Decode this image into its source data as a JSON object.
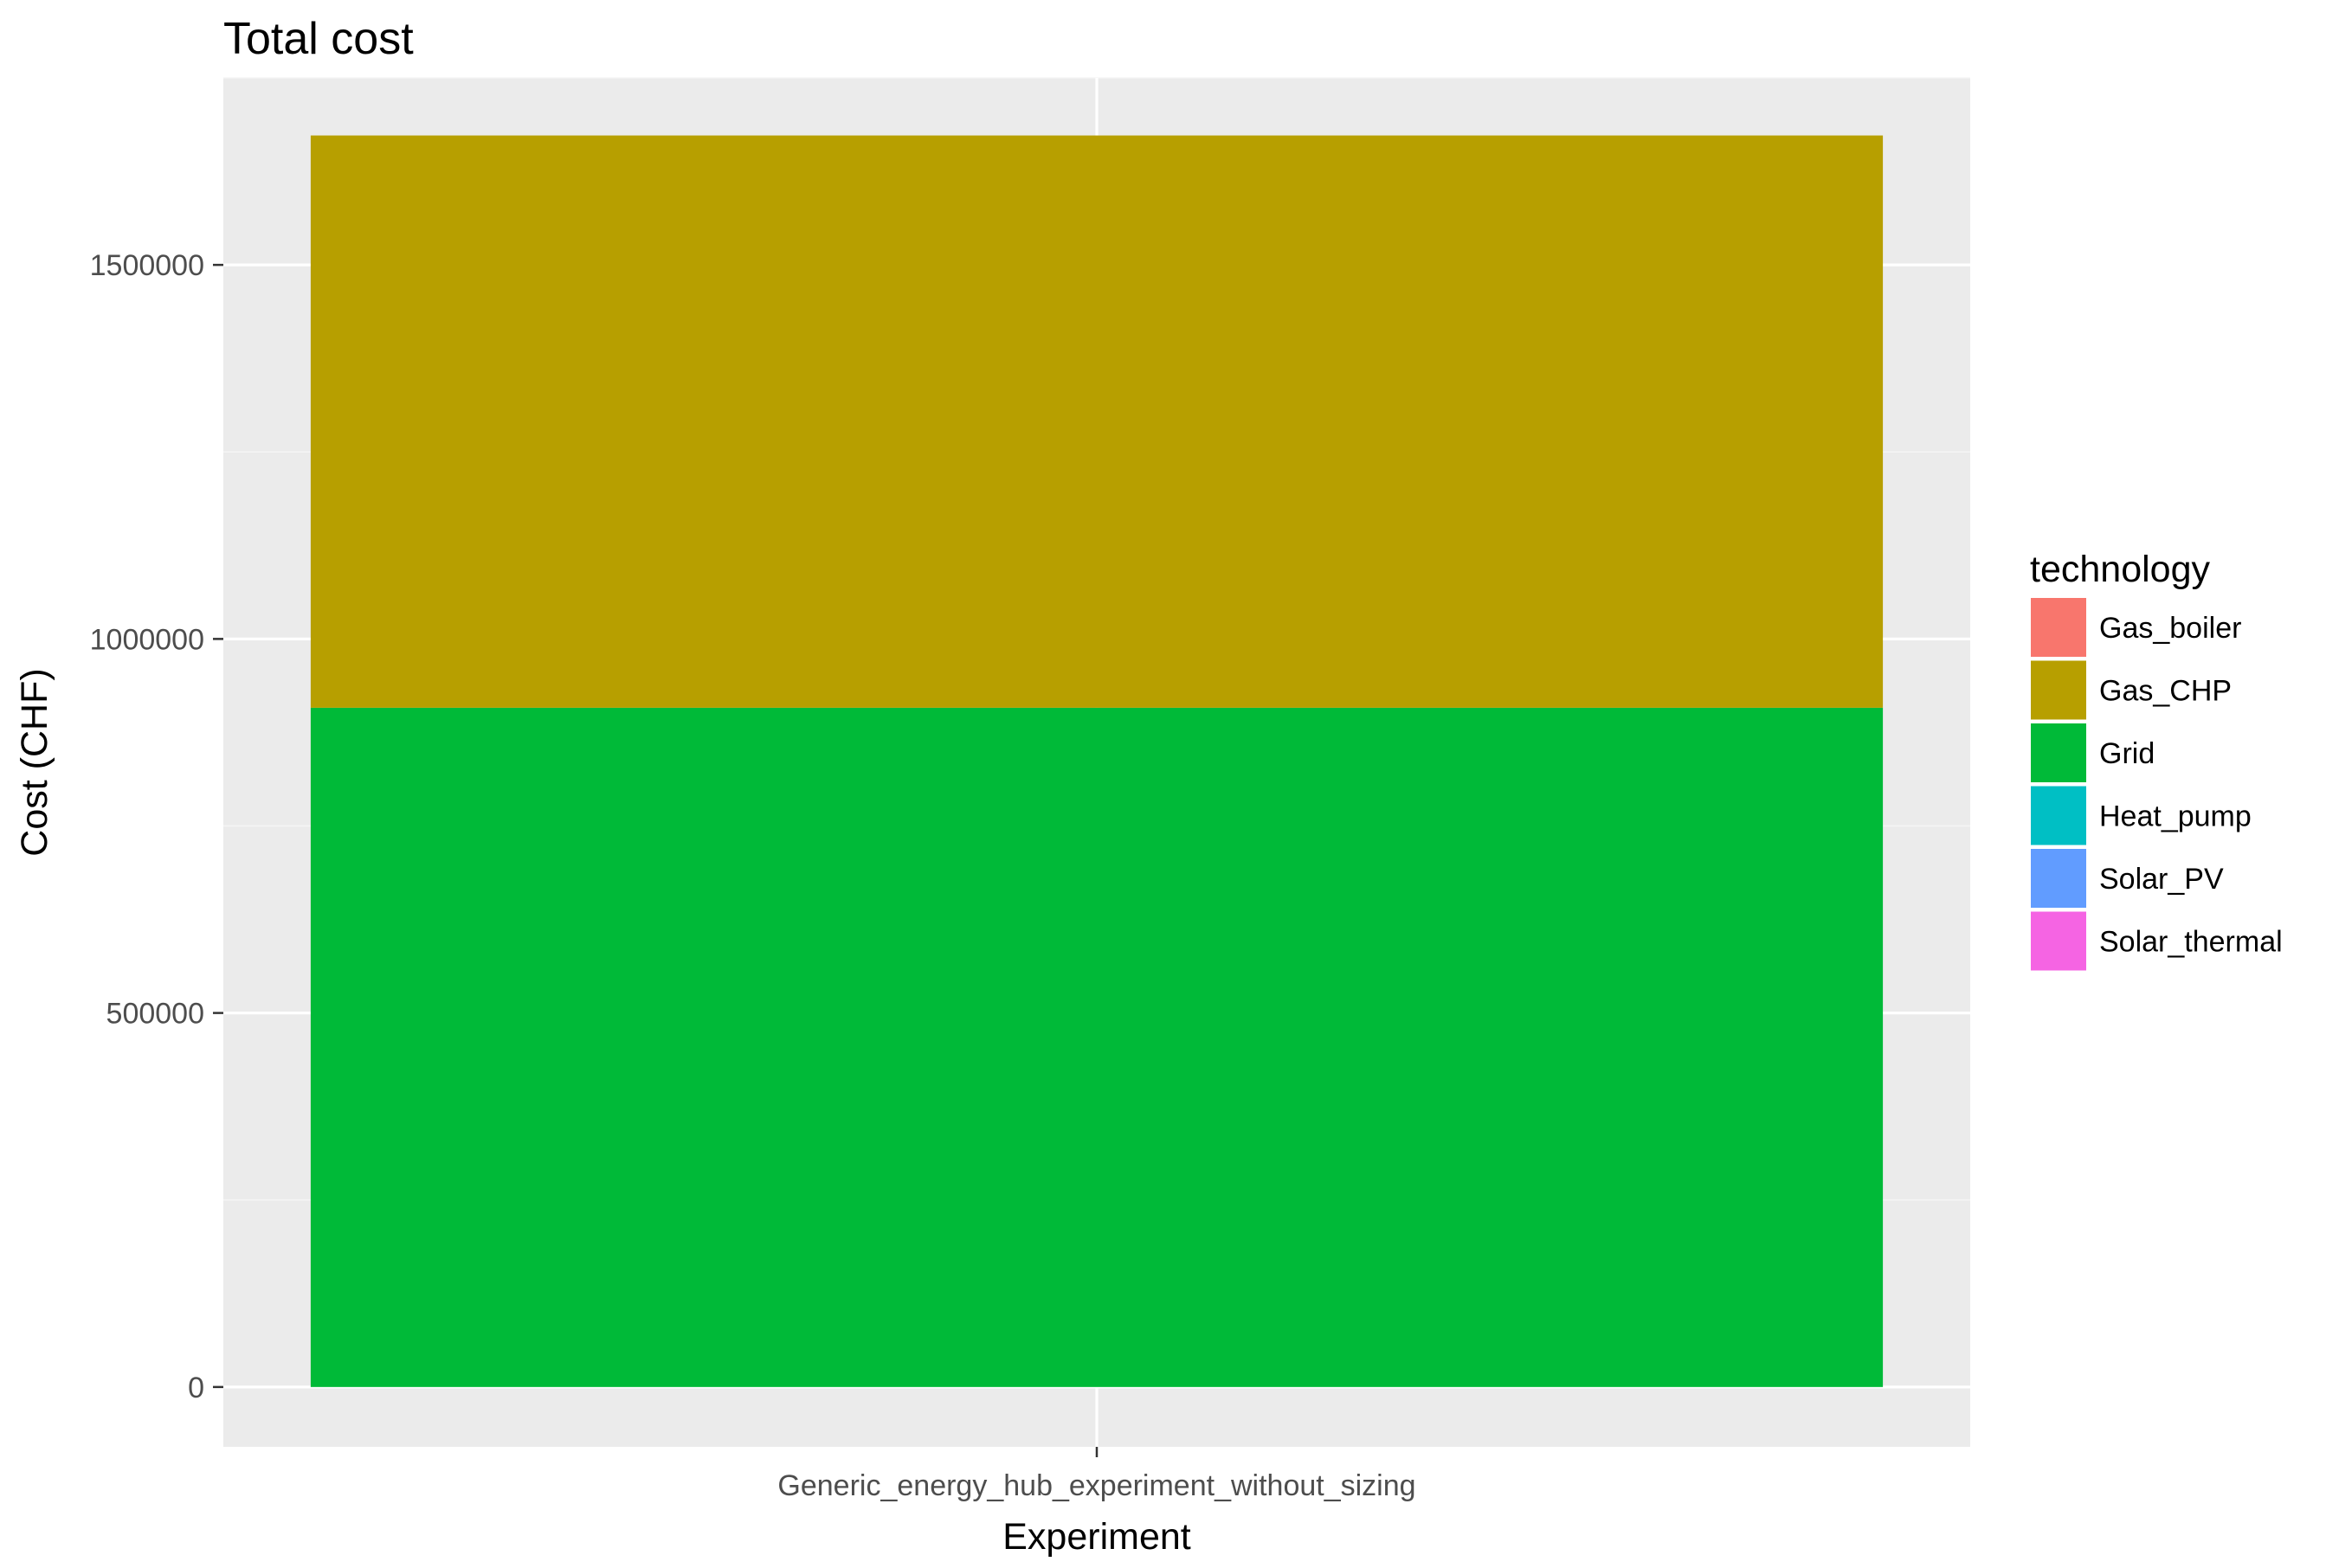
{
  "chart_data": {
    "type": "bar",
    "stacked": true,
    "title": "Total cost",
    "xlabel": "Experiment",
    "ylabel": "Cost (CHF)",
    "categories": [
      "Generic_energy_hub_experiment_without_sizing"
    ],
    "ylim": [
      -80000,
      1750000
    ],
    "yticks": [
      0,
      500000,
      1000000,
      1500000
    ],
    "ytick_labels": [
      "0",
      "500000",
      "1000000",
      "1500000"
    ],
    "grid": true,
    "legend": {
      "title": "technology",
      "position": "right",
      "entries": [
        {
          "name": "Gas_boiler",
          "color": "#F8766D"
        },
        {
          "name": "Gas_CHP",
          "color": "#B79F00"
        },
        {
          "name": "Grid",
          "color": "#00BA38"
        },
        {
          "name": "Heat_pump",
          "color": "#00BFC4"
        },
        {
          "name": "Solar_PV",
          "color": "#619CFF"
        },
        {
          "name": "Solar_thermal",
          "color": "#F564E3"
        }
      ]
    },
    "series": [
      {
        "name": "Gas_boiler",
        "color": "#F8766D",
        "values": [
          0
        ]
      },
      {
        "name": "Gas_CHP",
        "color": "#B79F00",
        "values": [
          765000
        ]
      },
      {
        "name": "Grid",
        "color": "#00BA38",
        "values": [
          908000
        ]
      },
      {
        "name": "Heat_pump",
        "color": "#00BFC4",
        "values": [
          0
        ]
      },
      {
        "name": "Solar_PV",
        "color": "#619CFF",
        "values": [
          0
        ]
      },
      {
        "name": "Solar_thermal",
        "color": "#F564E3",
        "values": [
          0
        ]
      }
    ],
    "stack_order_bottom_to_top": [
      "Solar_thermal",
      "Solar_PV",
      "Heat_pump",
      "Grid",
      "Gas_CHP",
      "Gas_boiler"
    ]
  }
}
